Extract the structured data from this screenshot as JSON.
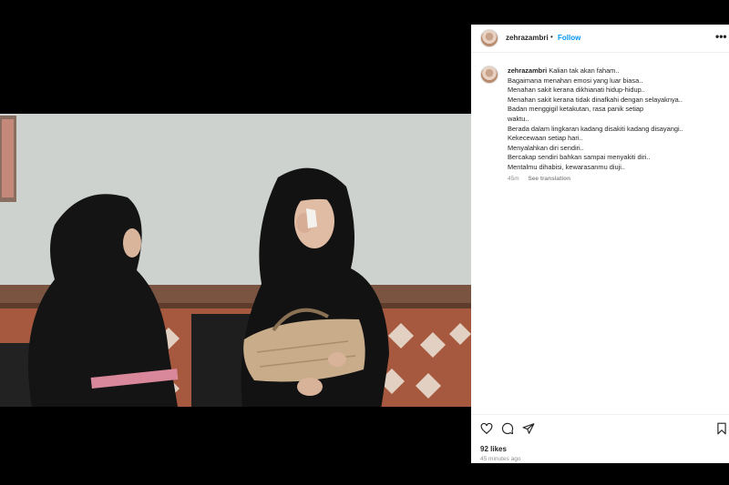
{
  "post": {
    "username": "zehrazambri",
    "separator": "•",
    "follow_label": "Follow",
    "more_label": "•••"
  },
  "caption": {
    "username": "zehrazambri",
    "first_line": "Kalian tak akan faham..",
    "lines": [
      "Bagaimana menahan emosi yang luar biasa..",
      "Menahan sakit kerana dikhianati hidup-hidup..",
      "Menahan sakit kerana tidak dinafkahi dengan selayaknya..",
      "Badan menggigil ketakutan, rasa panik setiap",
      "waktu..",
      "Berada dalam lingkaran kadang disakiti kadang disayangi..",
      "Kekecewaan setiap hari..",
      "Menyalahkan diri sendiri..",
      "Bercakap sendiri bahkan sampai menyakiti diri..",
      "Mentalmu dihabisi, kewarasanmu diuji.."
    ],
    "time": "45m",
    "translation_label": "See translation"
  },
  "footer": {
    "likes": "92 likes",
    "time_ago": "45 minutes ago",
    "icons": [
      "heart-icon",
      "comment-icon",
      "share-icon",
      "bookmark-icon"
    ]
  },
  "colors": {
    "accent": "#0095f6",
    "text": "#262626",
    "muted": "#8e8e8e"
  }
}
